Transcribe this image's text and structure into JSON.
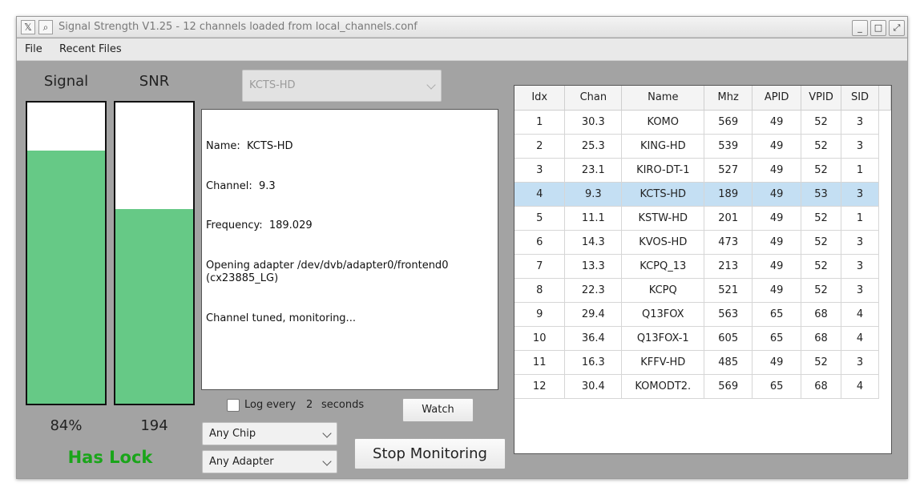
{
  "window": {
    "title": "Signal Strength V1.25 - 12 channels loaded from local_channels.conf",
    "buttons": {
      "minimize": "_",
      "maximize": "□",
      "close": "⤢"
    }
  },
  "menu": {
    "file": "File",
    "recent": "Recent Files"
  },
  "meters": {
    "signal_label": "Signal",
    "snr_label": "SNR",
    "signal_value": "84%",
    "snr_value": "194",
    "signal_level": 0.84,
    "snr_level": 0.645,
    "fill_color": "#66c986",
    "lock_text": "Has Lock",
    "lock_color": "#1aa51a"
  },
  "channel_select": {
    "value": "KCTS-HD"
  },
  "console": {
    "lines": [
      "Name:  KCTS-HD",
      "Channel:  9.3",
      "Frequency:  189.029",
      "Opening adapter /dev/dvb/adapter0/frontend0\n(cx23885_LG)",
      "Channel tuned, monitoring..."
    ]
  },
  "log": {
    "label": "Log every",
    "interval": "2",
    "unit": "seconds",
    "checked": false
  },
  "controls": {
    "watch": "Watch",
    "stop": "Stop Monitoring",
    "chip": "Any Chip",
    "adapter": "Any Adapter"
  },
  "table": {
    "columns": [
      "Idx",
      "Chan",
      "Name",
      "Mhz",
      "APID",
      "VPID",
      "SID"
    ],
    "selected_row": 3,
    "selection_color": "#c4dff3",
    "rows": [
      [
        "1",
        "30.3",
        "KOMO",
        "569",
        "49",
        "52",
        "3"
      ],
      [
        "2",
        "25.3",
        "KING-HD",
        "539",
        "49",
        "52",
        "3"
      ],
      [
        "3",
        "23.1",
        "KIRO-DT-1",
        "527",
        "49",
        "52",
        "1"
      ],
      [
        "4",
        "9.3",
        "KCTS-HD",
        "189",
        "49",
        "53",
        "3"
      ],
      [
        "5",
        "11.1",
        "KSTW-HD",
        "201",
        "49",
        "52",
        "1"
      ],
      [
        "6",
        "14.3",
        "KVOS-HD",
        "473",
        "49",
        "52",
        "3"
      ],
      [
        "7",
        "13.3",
        "KCPQ_13",
        "213",
        "49",
        "52",
        "3"
      ],
      [
        "8",
        "22.3",
        "KCPQ",
        "521",
        "49",
        "52",
        "3"
      ],
      [
        "9",
        "29.4",
        "Q13FOX",
        "563",
        "65",
        "68",
        "4"
      ],
      [
        "10",
        "36.4",
        "Q13FOX-1",
        "605",
        "65",
        "68",
        "4"
      ],
      [
        "11",
        "16.3",
        "KFFV-HD",
        "485",
        "49",
        "52",
        "3"
      ],
      [
        "12",
        "30.4",
        "KOMODT2.",
        "569",
        "65",
        "68",
        "4"
      ]
    ]
  }
}
